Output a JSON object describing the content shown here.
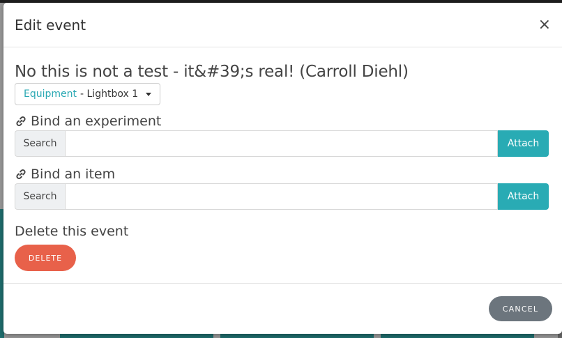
{
  "modal": {
    "title": "Edit event",
    "close_glyph": "×"
  },
  "event": {
    "title": "No this is not a test - it&#39;s real! (Carroll Diehl)",
    "category_link": "Equipment",
    "category_rest": "- Lightbox 1"
  },
  "bind_experiment": {
    "heading": "Bind an experiment",
    "icon": "link-icon",
    "addon": "Search",
    "value": "",
    "button": "Attach"
  },
  "bind_item": {
    "heading": "Bind an item",
    "icon": "link-icon",
    "addon": "Search",
    "value": "",
    "button": "Attach"
  },
  "delete_section": {
    "heading": "Delete this event",
    "button": "DELETE"
  },
  "footer": {
    "cancel": "CANCEL"
  },
  "colors": {
    "accent": "#29abb4",
    "danger": "#e8614a",
    "secondary": "#6c757d"
  }
}
